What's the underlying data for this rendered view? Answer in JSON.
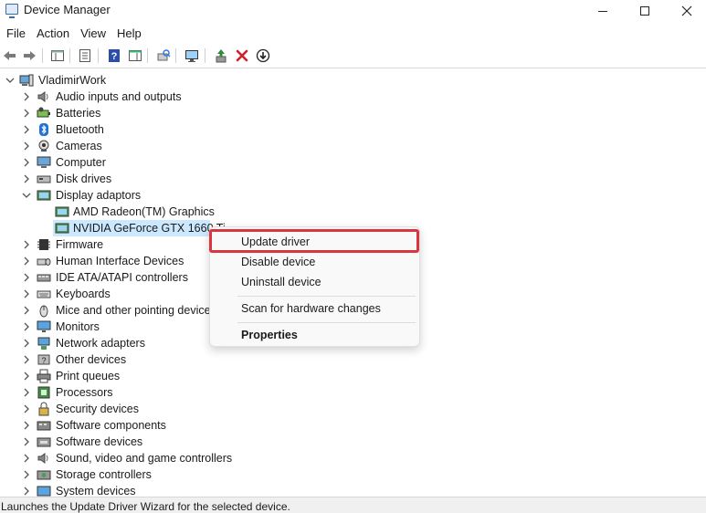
{
  "window": {
    "title": "Device Manager"
  },
  "menu": [
    "File",
    "Action",
    "View",
    "Help"
  ],
  "tree": {
    "root": "VladimirWork",
    "categories": [
      "Audio inputs and outputs",
      "Batteries",
      "Bluetooth",
      "Cameras",
      "Computer",
      "Disk drives",
      "Display adaptors",
      "Firmware",
      "Human Interface Devices",
      "IDE ATA/ATAPI controllers",
      "Keyboards",
      "Mice and other pointing devices",
      "Monitors",
      "Network adapters",
      "Other devices",
      "Print queues",
      "Processors",
      "Security devices",
      "Software components",
      "Software devices",
      "Sound, video and game controllers",
      "Storage controllers",
      "System devices"
    ],
    "display_children": [
      "AMD Radeon(TM) Graphics",
      "NVIDIA GeForce GTX 1660 Ti"
    ]
  },
  "context_menu": {
    "update": "Update driver",
    "disable": "Disable device",
    "uninstall": "Uninstall device",
    "scan": "Scan for hardware changes",
    "properties": "Properties"
  },
  "status": "Launches the Update Driver Wizard for the selected device.",
  "colors": {
    "selection": "#cce8ff",
    "highlight_border": "#d9363e",
    "delete_red": "#d0202a",
    "update_green": "#2e8b3a"
  }
}
